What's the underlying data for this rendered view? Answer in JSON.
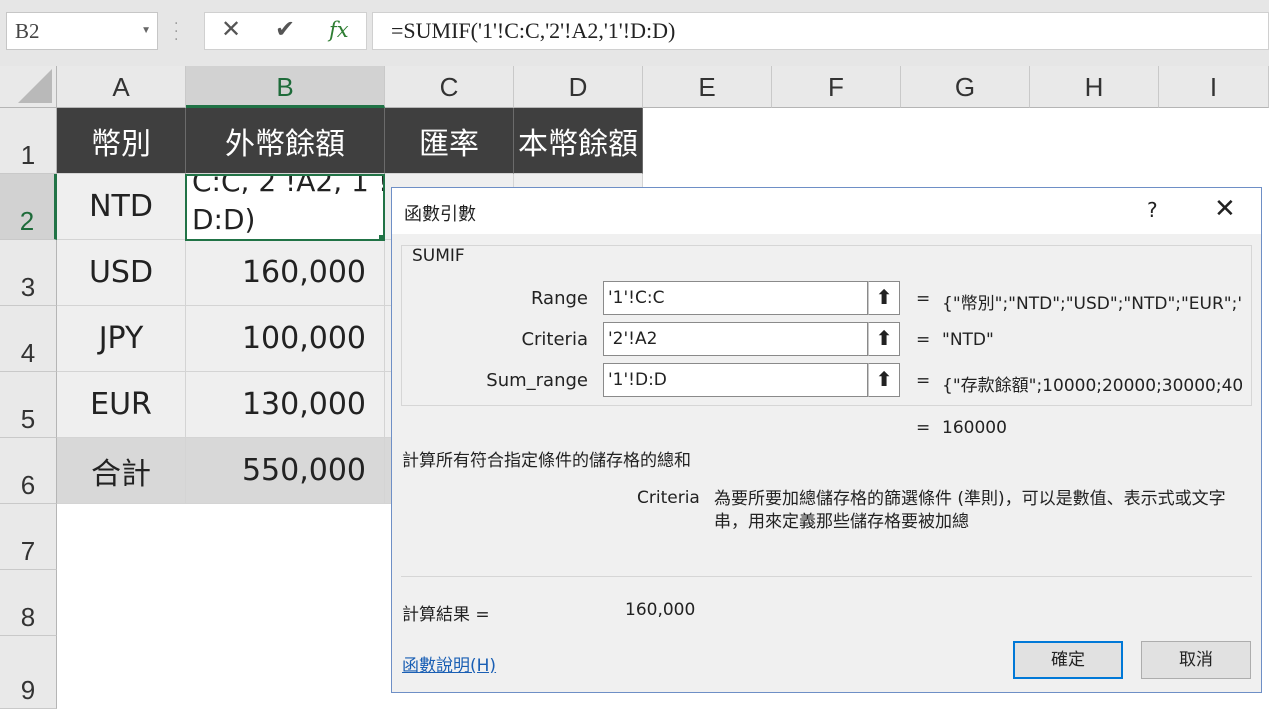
{
  "formula_bar": {
    "name_box": "B2",
    "cancel_glyph": "✕",
    "enter_glyph": "✔",
    "fx_glyph": "fx",
    "formula": "=SUMIF('1'!C:C,'2'!A2,'1'!D:D)"
  },
  "columns": [
    "A",
    "B",
    "C",
    "D",
    "E",
    "F",
    "G",
    "H",
    "I"
  ],
  "rows": [
    "1",
    "2",
    "3",
    "4",
    "5",
    "6",
    "7",
    "8",
    "9"
  ],
  "sheet": {
    "headers": {
      "a": "幣別",
      "b": "外幣餘額",
      "c": "匯率",
      "d": "本幣餘額"
    },
    "b2_line1": "C:C, 2 !A2, 1 !",
    "b2_line2": "D:D)",
    "rows": [
      {
        "a": "NTD"
      },
      {
        "a": "USD",
        "b": "160,000"
      },
      {
        "a": "JPY",
        "b": "100,000"
      },
      {
        "a": "EUR",
        "b": "130,000"
      },
      {
        "a": "合計",
        "b": "550,000"
      }
    ]
  },
  "dialog": {
    "title": "函數引數",
    "help_glyph": "?",
    "close_glyph": "✕",
    "function_name": "SUMIF",
    "args": [
      {
        "label": "Range",
        "value": "'1'!C:C",
        "result": "{\"幣別\";\"NTD\";\"USD\";\"NTD\";\"EUR\";\"N"
      },
      {
        "label": "Criteria",
        "value": "'2'!A2",
        "result": "\"NTD\""
      },
      {
        "label": "Sum_range",
        "value": "'1'!D:D",
        "result": "{\"存款餘額\";10000;20000;30000;40..."
      }
    ],
    "ref_button_glyph": "⬆",
    "equals": "=",
    "formula_result": "160000",
    "description": "計算所有符合指定條件的儲存格的總和",
    "arg_help_name": "Criteria",
    "arg_help_text": "為要所要加總儲存格的篩選條件 (準則)，可以是數值、表示式或文字串，用來定義那些儲存格要被加總",
    "calc_result_label": "計算結果 =",
    "calc_result_value": "160,000",
    "help_link": "函數說明(H)",
    "ok": "確定",
    "cancel": "取消"
  }
}
